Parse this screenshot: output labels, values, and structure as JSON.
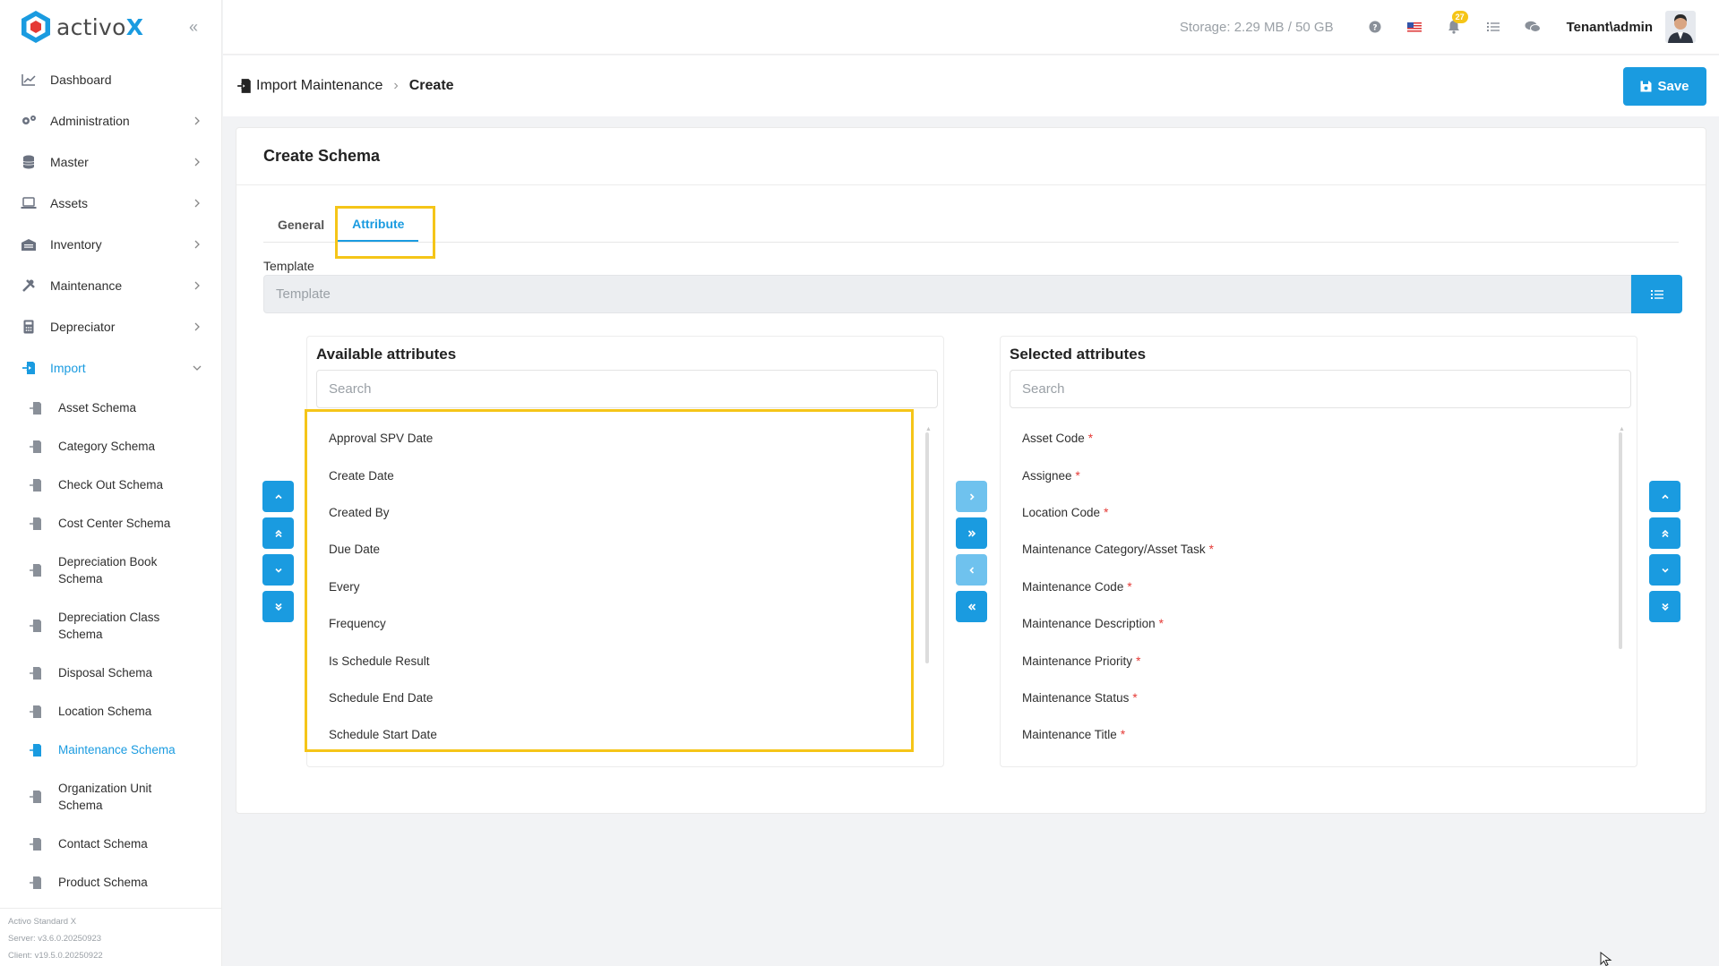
{
  "brand": {
    "name": "activo",
    "name_suffix": "X"
  },
  "sidebar": {
    "items": [
      {
        "label": "Dashboard",
        "icon": "chart-icon"
      },
      {
        "label": "Administration",
        "icon": "gears-icon"
      },
      {
        "label": "Master",
        "icon": "database-icon"
      },
      {
        "label": "Assets",
        "icon": "laptop-icon"
      },
      {
        "label": "Inventory",
        "icon": "warehouse-icon"
      },
      {
        "label": "Maintenance",
        "icon": "tools-icon"
      },
      {
        "label": "Depreciator",
        "icon": "calculator-icon"
      },
      {
        "label": "Import",
        "icon": "import-icon"
      }
    ],
    "import_sub": [
      "Asset Schema",
      "Category Schema",
      "Check Out Schema",
      "Cost Center Schema",
      "Depreciation Book Schema",
      "Depreciation Class Schema",
      "Disposal Schema",
      "Location Schema",
      "Maintenance Schema",
      "Organization Unit Schema",
      "Contact Schema",
      "Product Schema"
    ],
    "footer": {
      "product": "Activo Standard X",
      "server": "Server: v3.6.0.20250923",
      "client": "Client: v19.5.0.20250922"
    }
  },
  "topbar": {
    "storage": "Storage: 2.29 MB / 50 GB",
    "notification_count": "27",
    "user": "Tenant\\admin"
  },
  "header": {
    "breadcrumb_parent": "Import Maintenance",
    "breadcrumb_current": "Create",
    "save_label": "Save"
  },
  "card": {
    "title": "Create Schema",
    "tabs": [
      "General",
      "Attribute"
    ],
    "active_tab": "Attribute",
    "template_label": "Template",
    "template_placeholder": "Template"
  },
  "available": {
    "title": "Available attributes",
    "search_placeholder": "Search",
    "items": [
      "Approval SPV Date",
      "Create Date",
      "Created By",
      "Due Date",
      "Every",
      "Frequency",
      "Is Schedule Result",
      "Schedule End Date",
      "Schedule Start Date"
    ]
  },
  "selected": {
    "title": "Selected attributes",
    "search_placeholder": "Search",
    "required_marker": "*",
    "items": [
      "Asset Code",
      "Assignee",
      "Location Code",
      "Maintenance Category/Asset Task",
      "Maintenance Code",
      "Maintenance Description",
      "Maintenance Priority",
      "Maintenance Status",
      "Maintenance Title"
    ]
  },
  "colors": {
    "accent": "#1a9be0",
    "highlight": "#f5c518",
    "required": "#e53935"
  }
}
